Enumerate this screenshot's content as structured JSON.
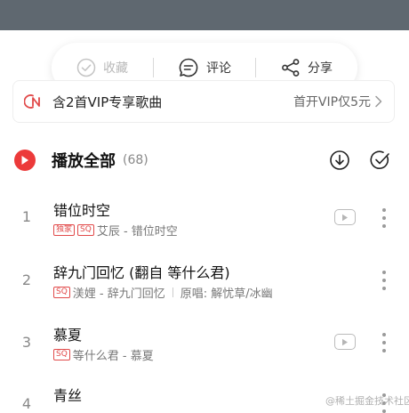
{
  "actions": {
    "favorite_label": "收藏",
    "comment_label": "评论",
    "share_label": "分享"
  },
  "vip_banner": {
    "text": "含2首VIP专享歌曲",
    "cta": "首开VIP仅5元",
    "accent": "#e14a4a"
  },
  "play_all": {
    "label": "播放全部",
    "count": "(68)",
    "accent": "#ec3a3a"
  },
  "songs": [
    {
      "index": "1",
      "title": "错位时空",
      "tags": [
        "独家",
        "SQ"
      ],
      "artist_album": "艾辰 - 错位时空",
      "note": ""
    },
    {
      "index": "2",
      "title": "辞九门回忆 (翻自 等什么君)",
      "tags": [
        "SQ"
      ],
      "artist_album": "渼娌 - 辞九门回忆",
      "note": "原唱: 解忧草/冰幽"
    },
    {
      "index": "3",
      "title": "慕夏",
      "tags": [
        "SQ"
      ],
      "artist_album": "等什么君 - 慕夏",
      "note": ""
    },
    {
      "index": "4",
      "title": "青丝",
      "tags": [],
      "artist_album": "",
      "note": ""
    }
  ],
  "watermark": "@稀土掘金技术社区"
}
